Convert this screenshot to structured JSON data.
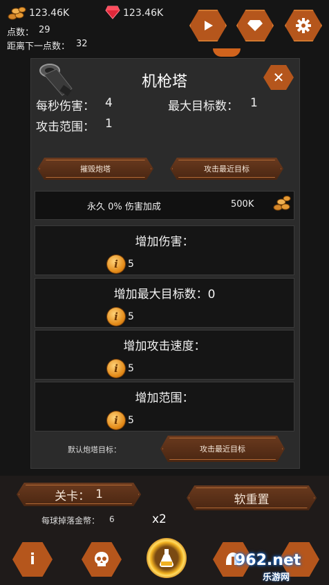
{
  "hud": {
    "gold": "123.46K",
    "gems": "123.46K",
    "points_label": "点数：",
    "points_value": "29",
    "next_point_label": "距离下一点数：",
    "next_point_value": "32"
  },
  "panel": {
    "title": "机枪塔",
    "dps_label": "每秒伤害：",
    "dps_value": "4",
    "max_targets_label": "最大目标数：",
    "max_targets_value": "1",
    "range_label": "攻击范围：",
    "range_value": "1",
    "destroy_button": "摧毁炮塔",
    "target_button": "攻击最近目标",
    "bonus_text": "永久 0% 伤害加成",
    "bonus_cost": "500K",
    "upgrades": [
      {
        "label": "增加伤害：",
        "cost": "5"
      },
      {
        "label": "增加最大目标数：0",
        "cost": "5"
      },
      {
        "label": "增加攻击速度：",
        "cost": "5"
      },
      {
        "label": "增加范围：",
        "cost": "5"
      }
    ],
    "default_target_label": "默认炮塔目标：",
    "default_target_button": "攻击最近目标"
  },
  "bottom": {
    "level_label": "关卡：",
    "level_value": "1",
    "soft_reset": "软重置",
    "gold_per_ball_label": "每球掉落金幣：",
    "gold_per_ball_value": "6",
    "multiplier": "x2"
  },
  "watermark": {
    "text": "962.net",
    "sub": "乐游网"
  },
  "colors": {
    "accent": "#b5561c",
    "panel": "#2b2b2b",
    "background": "#151515"
  }
}
